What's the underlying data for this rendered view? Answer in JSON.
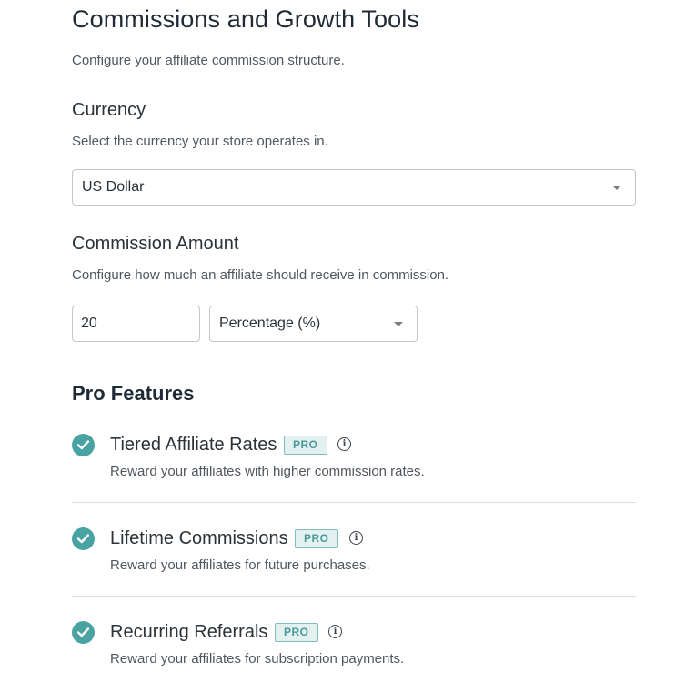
{
  "page": {
    "title": "Commissions and Growth Tools",
    "subtitle": "Configure your affiliate commission structure."
  },
  "currency": {
    "label": "Currency",
    "description": "Select the currency your store operates in.",
    "selected": "US Dollar"
  },
  "commission": {
    "label": "Commission Amount",
    "description": "Configure how much an affiliate should receive in commission.",
    "amount": "20",
    "type_selected": "Percentage (%)"
  },
  "pro_features": {
    "title": "Pro Features",
    "badge_label": "PRO",
    "items": [
      {
        "name": "Tiered Affiliate Rates",
        "description": "Reward your affiliates with higher commission rates.",
        "enabled": true
      },
      {
        "name": "Lifetime Commissions",
        "description": "Reward your affiliates for future purchases.",
        "enabled": true
      },
      {
        "name": "Recurring Referrals",
        "description": "Reward your affiliates for subscription payments.",
        "enabled": true
      }
    ]
  },
  "icons": {
    "check": "check-circle-icon",
    "info": "info-icon",
    "caret": "chevron-down-icon"
  },
  "colors": {
    "accent": "#4aa3a3",
    "badge_bg": "#e3f1f1",
    "badge_border": "#7fbcbc",
    "text": "#2c3338"
  }
}
